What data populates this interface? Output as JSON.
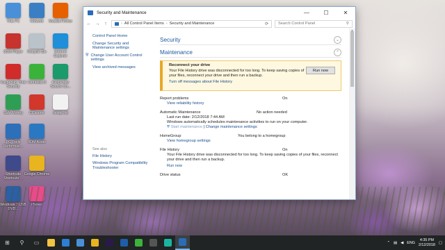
{
  "desktop": {
    "icons": [
      {
        "label": "This PC",
        "color": "#4a90d9"
      },
      {
        "label": "Network",
        "color": "#3a7fc4"
      },
      {
        "label": "Mozilla Firefox",
        "color": "#e66000"
      },
      {
        "label": "8OM Player",
        "color": "#c7342f"
      },
      {
        "label": "Recycle Bin",
        "color": "#b9c3c9"
      },
      {
        "label": "Internet Explorer",
        "color": "#1e8fd8"
      },
      {
        "label": "Kaspersky Total Security",
        "color": "#d12c2c"
      },
      {
        "label": "Camtasia 8",
        "color": "#3bb33b"
      },
      {
        "label": "Kaspersky Secure Co...",
        "color": "#1b9a6b"
      },
      {
        "label": "Safe Money",
        "color": "#2f9e55"
      },
      {
        "label": "CCleaner",
        "color": "#d1372b"
      },
      {
        "label": "newpc.txt",
        "color": "#f2f2f2"
      },
      {
        "label": "PC Tools Performan...",
        "color": "#2d6fb8"
      },
      {
        "label": "8OM Audio",
        "color": "#2b78c2"
      },
      {
        "label": "Shortcuts Shortcuts ...",
        "color": "#3e4a8a"
      },
      {
        "label": "Google Chrome",
        "color": "#e8b420"
      },
      {
        "label": "Windows 7 USB DVD...",
        "color": "#2b5fa6"
      },
      {
        "label": "iTunes",
        "color": "#e84b8a"
      }
    ]
  },
  "window": {
    "title": "Security and Maintenance",
    "controls": {
      "minimize": "—",
      "maximize": "☐",
      "close": "✕"
    },
    "address": {
      "crumb1": "All Control Panel Items",
      "sep": "›",
      "crumb2": "Security and Maintenance"
    },
    "search": {
      "placeholder": "Search Control Panel"
    },
    "left_nav": {
      "home": "Control Panel Home",
      "change_settings": "Change Security and Maintenance settings",
      "change_uac": "Change User Account Control settings",
      "archived": "View archived messages",
      "see_also_heading": "See also",
      "file_history": "File History",
      "compat": "Windows Program Compatibility Troubleshooter"
    },
    "security_heading": "Security",
    "maintenance_heading": "Maintenance",
    "alert": {
      "title": "Reconnect your drive",
      "body": "Your File History drive was disconnected for too long. To keep saving copies of your files, reconnect your drive and then run a backup.",
      "link": "Turn off messages about File History",
      "button": "Run now"
    },
    "report_problems": {
      "label": "Report problems",
      "value": "On",
      "link": "View reliability history"
    },
    "auto_maintenance": {
      "label": "Automatic Maintenance",
      "value": "No action needed",
      "last_run": "Last run date: 2/12/2018 7:44 AM",
      "desc": "Windows automatically schedules maintenance activities to run on your computer.",
      "start_link": "Start maintenance",
      "pipe": "|",
      "change_link": "Change maintenance settings"
    },
    "homegroup": {
      "label": "HomeGroup",
      "value": "You belong to a homegroup",
      "link": "View homegroup settings"
    },
    "file_history": {
      "label": "File History",
      "value": "On",
      "desc": "Your File History drive was disconnected for too long. To keep saving copies of your files, reconnect your drive and then run a backup.",
      "link": "Run now"
    },
    "drive_status": {
      "label": "Drive status",
      "value": "OK"
    }
  },
  "taskbar": {
    "start_icon": "windows-logo-icon",
    "apps": [
      {
        "name": "explorer",
        "color": "#f3c342"
      },
      {
        "name": "edge",
        "color": "#2b7fd6"
      },
      {
        "name": "store",
        "color": "#4a90d9"
      },
      {
        "name": "chrome",
        "color": "#e8b420"
      },
      {
        "name": "premiere",
        "color": "#2a1a4a"
      },
      {
        "name": "photoshop",
        "color": "#1f5da8"
      },
      {
        "name": "camtasia",
        "color": "#3bb33b"
      },
      {
        "name": "clip",
        "color": "#555555"
      },
      {
        "name": "recorder",
        "color": "#1ab5a0"
      },
      {
        "name": "control-panel",
        "color": "#2b6cb5"
      }
    ],
    "tray": {
      "lang": "ENG",
      "time": "4:35 PM",
      "date": "2/12/2018"
    }
  }
}
